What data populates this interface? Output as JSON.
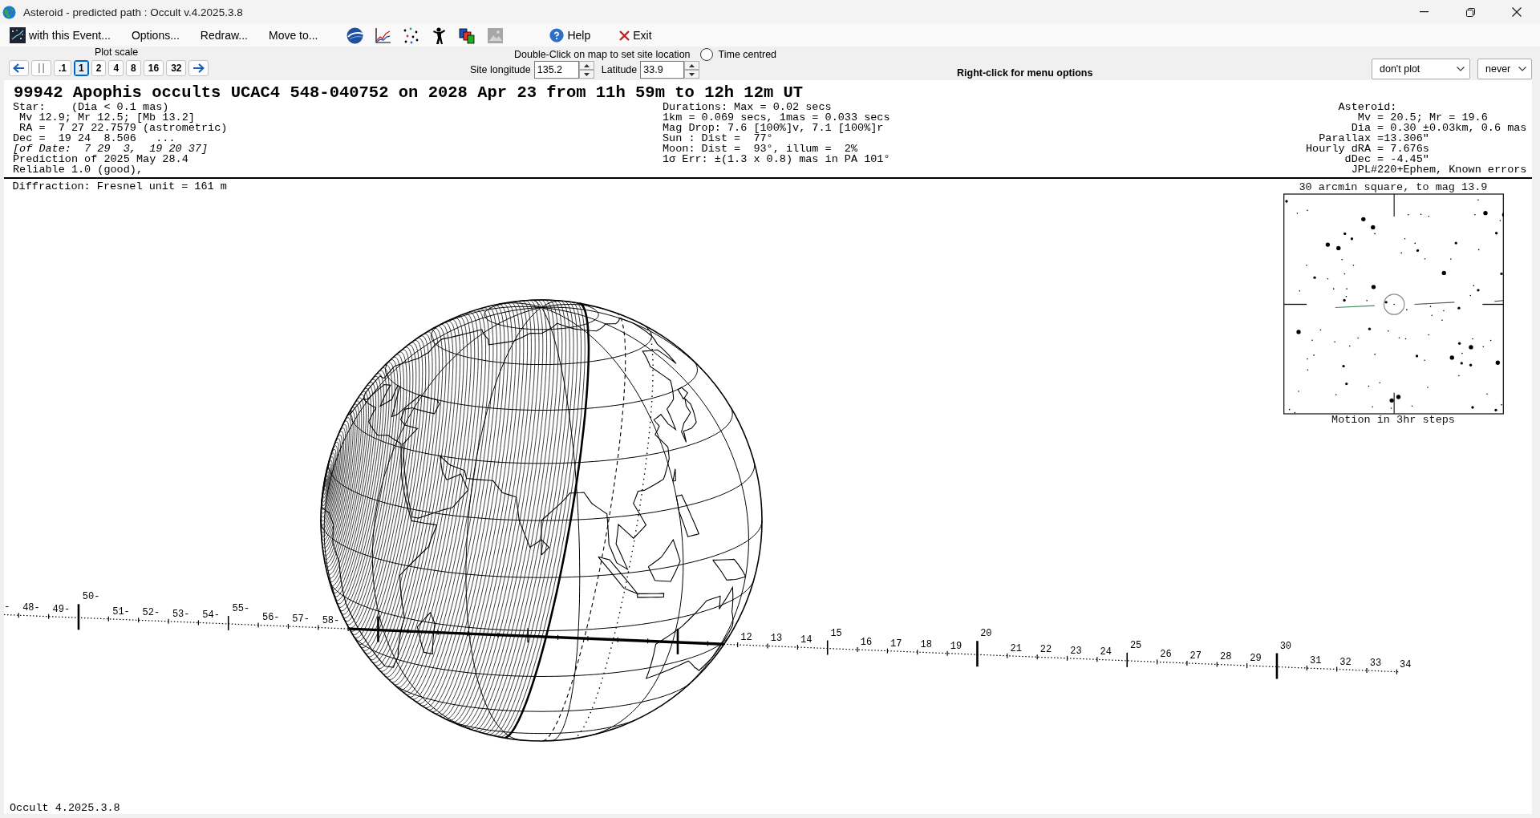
{
  "window": {
    "title": "Asteroid - predicted path : Occult v.4.2025.3.8"
  },
  "menu": {
    "items": [
      {
        "label": "with this Event...",
        "kind": "event"
      },
      {
        "label": "Options...",
        "kind": "plain"
      },
      {
        "label": "Redraw...",
        "kind": "plain"
      },
      {
        "label": "Move to...",
        "kind": "plain"
      }
    ],
    "actions": [
      {
        "label": "Help",
        "kind": "help"
      },
      {
        "label": "Exit",
        "kind": "exit"
      }
    ]
  },
  "plot_scale": {
    "label": "Plot scale",
    "options": [
      {
        "label": ".1",
        "selected": false
      },
      {
        "label": "1",
        "selected": true
      },
      {
        "label": "2",
        "selected": false
      },
      {
        "label": "4",
        "selected": false
      },
      {
        "label": "8",
        "selected": false
      },
      {
        "label": "16",
        "selected": false
      },
      {
        "label": "32",
        "selected": false
      }
    ]
  },
  "site": {
    "hint": "Double-Click on map to set site location",
    "time_centred": {
      "label": "Time centred",
      "checked": false
    },
    "longitude": {
      "label": "Site longitude",
      "value": "135.2"
    },
    "latitude": {
      "label": "Latitude",
      "value": "33.9"
    }
  },
  "menu_hint": "Right-click for menu options",
  "dropdowns": [
    {
      "value": "don't plot"
    },
    {
      "value": "never"
    }
  ],
  "event": {
    "title": "99942 Apophis occults UCAC4 548-040752 on 2028 Apr 23 from 11h 59m to 12h 12m UT",
    "star": [
      {
        "text": "Star:    (Dia < 0.1 mas)",
        "italic": false
      },
      {
        "text": "Mv 12.9; Mr 12.5; [Mb 13.2]",
        "italic": false
      },
      {
        "text": "RA =  7 27 22.7579 (astrometric)",
        "italic": false
      },
      {
        "text": "Dec =  19 24  8.506   ...",
        "italic": false
      },
      {
        "text": "[of Date:  7 29  3,  19 20 37]",
        "italic": true
      },
      {
        "text": "Prediction of 2025 May 28.4",
        "italic": false
      },
      {
        "text": "Reliable 1.0 (good),",
        "italic": false
      }
    ],
    "circumstances": [
      "Durations: Max = 0.02 secs",
      "1km = 0.069 secs, 1mas = 0.033 secs",
      "Mag Drop: 7.6 [100%]v, 7.1 [100%]r",
      "Sun : Dist =  77°",
      "Moon: Dist =  93°, illum =  2%",
      "1σ Err: ±(1.3 x 0.8) mas in PA 101°"
    ],
    "asteroid": [
      "Asteroid:",
      "Mv = 20.5; Mr = 19.6",
      "Dia = 0.30 ±0.03km, 0.6 mas",
      "Parallax =13.306\"",
      "Hourly dRA = 7.676s",
      "dDec = -4.45\"",
      "JPL#220+Ephem, Known errors"
    ]
  },
  "map": {
    "diffraction": "Diffraction: Fresnel unit = 161 m",
    "labels_before": [
      {
        "text": "-",
        "kind": "small"
      },
      {
        "text": "48-",
        "kind": "small"
      },
      {
        "text": "49-",
        "kind": "small"
      },
      {
        "text": "50-",
        "kind": "large"
      },
      {
        "text": "51-",
        "kind": "small"
      },
      {
        "text": "52-",
        "kind": "small"
      },
      {
        "text": "53-",
        "kind": "small"
      },
      {
        "text": "54-",
        "kind": "small"
      },
      {
        "text": "55-",
        "kind": "medium"
      },
      {
        "text": "56-",
        "kind": "small"
      },
      {
        "text": "57-",
        "kind": "small"
      },
      {
        "text": "58-",
        "kind": "small"
      }
    ],
    "labels_after": [
      {
        "text": "12",
        "kind": "small"
      },
      {
        "text": "13",
        "kind": "small"
      },
      {
        "text": "14",
        "kind": "small"
      },
      {
        "text": "15",
        "kind": "medium"
      },
      {
        "text": "16",
        "kind": "small"
      },
      {
        "text": "17",
        "kind": "small"
      },
      {
        "text": "18",
        "kind": "small"
      },
      {
        "text": "19",
        "kind": "small"
      },
      {
        "text": "20",
        "kind": "large"
      },
      {
        "text": "21",
        "kind": "small"
      },
      {
        "text": "22",
        "kind": "small"
      },
      {
        "text": "23",
        "kind": "small"
      },
      {
        "text": "24",
        "kind": "small"
      },
      {
        "text": "25",
        "kind": "medium"
      },
      {
        "text": "26",
        "kind": "small"
      },
      {
        "text": "27",
        "kind": "small"
      },
      {
        "text": "28",
        "kind": "small"
      },
      {
        "text": "29",
        "kind": "small"
      },
      {
        "text": "30",
        "kind": "large"
      },
      {
        "text": "31",
        "kind": "small"
      },
      {
        "text": "32",
        "kind": "small"
      },
      {
        "text": "33",
        "kind": "small"
      },
      {
        "text": "34",
        "kind": "small"
      }
    ],
    "version": "Occult 4.2025.3.8"
  },
  "finder_chart": {
    "title": "30 arcmin square, to mag 13.9",
    "caption": "Motion in 3hr steps"
  }
}
